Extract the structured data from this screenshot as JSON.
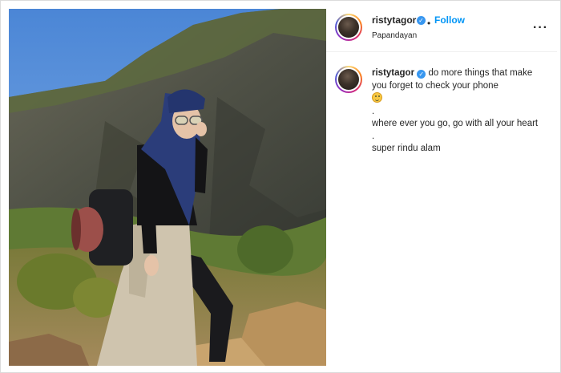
{
  "post": {
    "username": "ristytagor",
    "verified_icon": "verified-badge-icon",
    "separator": "•",
    "follow_label": "Follow",
    "location": "Papandayan",
    "more_icon": "more-options-icon",
    "more_label": "···"
  },
  "caption": {
    "username": "ristytagor",
    "text_line1": "do more things that make you forget to check your phone",
    "emoji": "grinning-sweat-emoji",
    "dot1": ".",
    "text_line2": "where ever you go, go with all your heart",
    "dot2": ".",
    "text_line3": "super rindu alam"
  },
  "colors": {
    "accent": "#0095f6",
    "verified": "#3897f0",
    "text": "#262626",
    "sky": "#5a8fd8"
  },
  "image": {
    "description_icon": "mountain-photo"
  }
}
